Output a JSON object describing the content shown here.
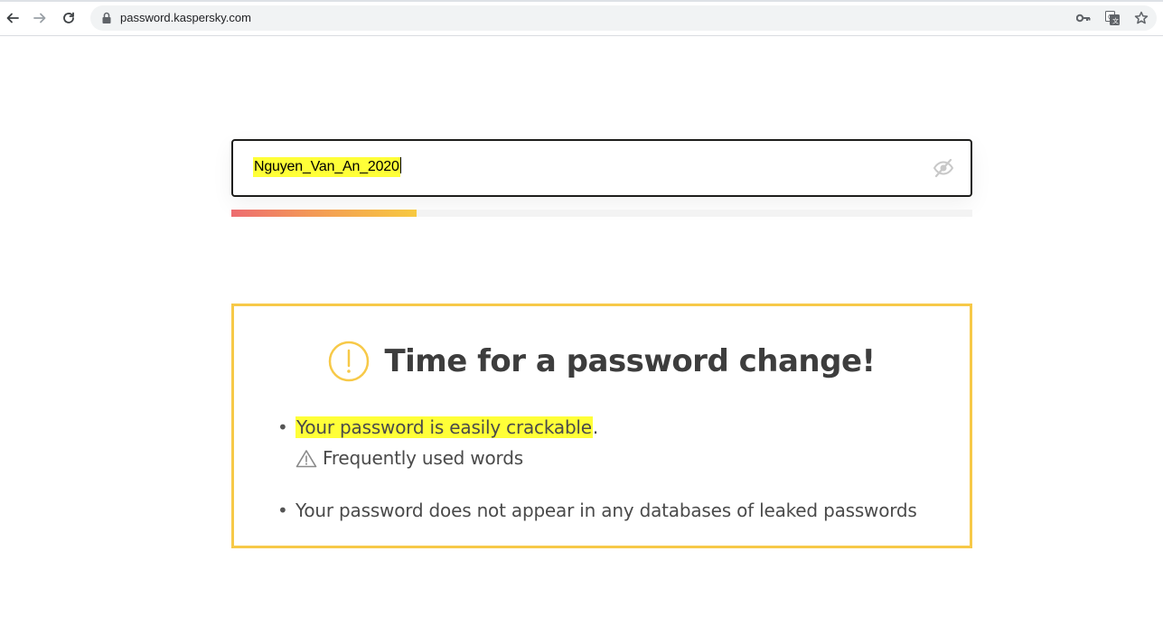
{
  "browser": {
    "url": "password.kaspersky.com",
    "back_icon": "back-arrow-icon",
    "forward_icon": "forward-arrow-icon",
    "reload_icon": "reload-icon",
    "lock_icon": "lock-icon",
    "key_icon": "key-icon",
    "translate_icon": "translate-icon",
    "bookmark_icon": "star-icon"
  },
  "password_field": {
    "value": "Nguyen_Van_An_2020",
    "visibility_icon": "eye-slash-icon"
  },
  "strength_meter": {
    "fill_fraction": 0.25,
    "gradient_colors": [
      "#ed6c70",
      "#f39a55",
      "#f7c940"
    ],
    "track_color": "#f3f3f3"
  },
  "result": {
    "border_color": "#f7c948",
    "title": "Time for a password change!",
    "title_icon": "exclamation-circle-icon",
    "items": [
      {
        "highlighted_text": "Your password is easily crackable",
        "trailing_text": ".",
        "sub_icon": "warning-triangle-icon",
        "sub_text": "Frequently used words"
      },
      {
        "text": "Your password does not appear in any databases of leaked passwords"
      }
    ]
  },
  "highlight_color": "#ffff38"
}
